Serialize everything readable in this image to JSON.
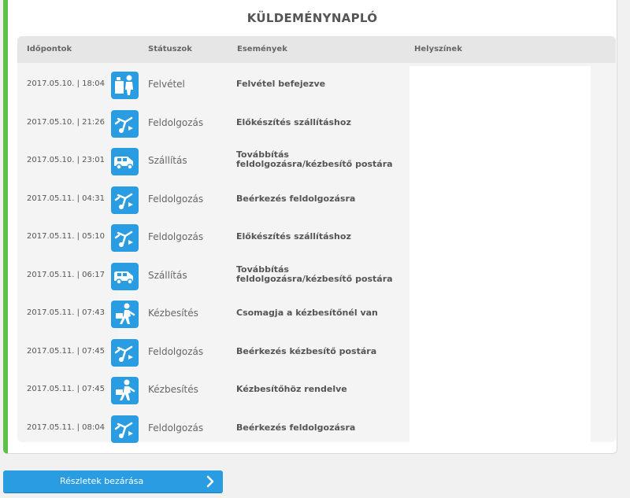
{
  "title": "KÜLDEMÉNYNAPLÓ",
  "columns": {
    "time": "Időpontok",
    "status": "Státuszok",
    "events": "Események",
    "location": "Helyszínek"
  },
  "rows": [
    {
      "time": "2017.05.10. | 18:04",
      "icon": "pickup-icon",
      "status": "Felvétel",
      "event": "Felvétel befejezve"
    },
    {
      "time": "2017.05.10. | 21:26",
      "icon": "processing-icon",
      "status": "Feldolgozás",
      "event": "Előkészítés szállításhoz"
    },
    {
      "time": "2017.05.10. | 23:01",
      "icon": "van-icon",
      "status": "Szállítás",
      "event": "Továbbítás feldolgozásra/kézbesítő postára"
    },
    {
      "time": "2017.05.11. | 04:31",
      "icon": "processing-icon",
      "status": "Feldolgozás",
      "event": "Beérkezés feldolgozásra"
    },
    {
      "time": "2017.05.11. | 05:10",
      "icon": "processing-icon",
      "status": "Feldolgozás",
      "event": "Előkészítés szállításhoz"
    },
    {
      "time": "2017.05.11. | 06:17",
      "icon": "van-icon",
      "status": "Szállítás",
      "event": "Továbbítás feldolgozásra/kézbesítő postára"
    },
    {
      "time": "2017.05.11. | 07:43",
      "icon": "courier-icon",
      "status": "Kézbesítés",
      "event": "Csomagja a kézbesítőnél van"
    },
    {
      "time": "2017.05.11. | 07:45",
      "icon": "processing-icon",
      "status": "Feldolgozás",
      "event": "Beérkezés kézbesítő postára"
    },
    {
      "time": "2017.05.11. | 07:45",
      "icon": "courier-icon",
      "status": "Kézbesítés",
      "event": "Kézbesítőhöz rendelve"
    },
    {
      "time": "2017.05.11. | 08:04",
      "icon": "processing-icon",
      "status": "Feldolgozás",
      "event": "Beérkezés feldolgozásra"
    }
  ],
  "close_button": {
    "label": "Részletek bezárása",
    "icon": "chevron-right-icon"
  },
  "colors": {
    "accent_green": "#5cc049",
    "icon_blue": "#2a9ce2"
  }
}
